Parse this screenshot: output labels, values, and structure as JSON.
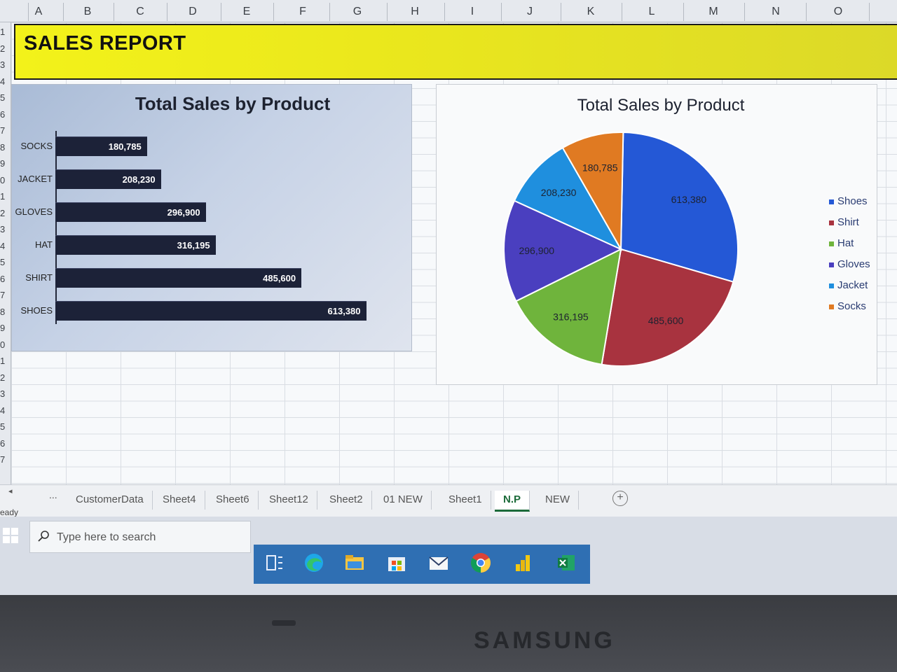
{
  "spreadsheet": {
    "columns": [
      "A",
      "B",
      "C",
      "D",
      "E",
      "F",
      "G",
      "H",
      "I",
      "J",
      "K",
      "L",
      "M",
      "N",
      "O"
    ],
    "rows": [
      "1",
      "2",
      "3",
      "4",
      "5",
      "6",
      "7",
      "8",
      "9",
      "0",
      "1",
      "2",
      "3",
      "4",
      "5",
      "6",
      "7",
      "8",
      "9",
      "0",
      "1",
      "2",
      "3",
      "4",
      "5",
      "6",
      "7"
    ]
  },
  "banner": {
    "title": "SALES REPORT",
    "color": "#f3f21a"
  },
  "bar_chart_panel": {
    "title": "Total Sales by  Product"
  },
  "pie_chart_panel": {
    "title": "Total Sales by  Product"
  },
  "chart_data": [
    {
      "type": "bar",
      "orientation": "horizontal",
      "title": "Total Sales by  Product",
      "categories": [
        "SOCKS",
        "JACKET",
        "GLOVES",
        "HAT",
        "SHIRT",
        "SHOES"
      ],
      "values": [
        180785,
        208230,
        296900,
        316195,
        485600,
        613380
      ],
      "value_labels": [
        "180,785",
        "208,230",
        "296,900",
        "316,195",
        "485,600",
        "613,380"
      ],
      "xlim": [
        0,
        650000
      ],
      "bar_color": "#1c2238",
      "grid": false,
      "legend": false
    },
    {
      "type": "pie",
      "title": "Total Sales by  Product",
      "categories": [
        "Shoes",
        "Shirt",
        "Hat",
        "Gloves",
        "Jacket",
        "Socks"
      ],
      "values": [
        613380,
        485600,
        316195,
        296900,
        208230,
        180785
      ],
      "value_labels": [
        "613,380",
        "485,600",
        "316,195",
        "296,900",
        "208,230",
        "180,785"
      ],
      "colors": [
        "#2458d6",
        "#a8333f",
        "#6fb43c",
        "#4a3fbf",
        "#1f8fde",
        "#e07a22"
      ],
      "legend": "right"
    }
  ],
  "sheet_tabs": {
    "nav_arrow": "◂",
    "more": "...",
    "tabs": [
      "CustomerData",
      "Sheet4",
      "Sheet6",
      "Sheet12",
      "Sheet2",
      "01 NEW",
      "Sheet1",
      "N.P",
      "NEW"
    ],
    "active": "N.P",
    "add_symbol": "+"
  },
  "status": {
    "text": "eady"
  },
  "taskbar": {
    "search_placeholder": "Type here to search",
    "apps": [
      "task-view",
      "edge",
      "file-explorer",
      "microsoft-store",
      "mail",
      "chrome",
      "power-bi",
      "excel"
    ]
  },
  "bezel": {
    "brand": "SAMSUNG"
  }
}
